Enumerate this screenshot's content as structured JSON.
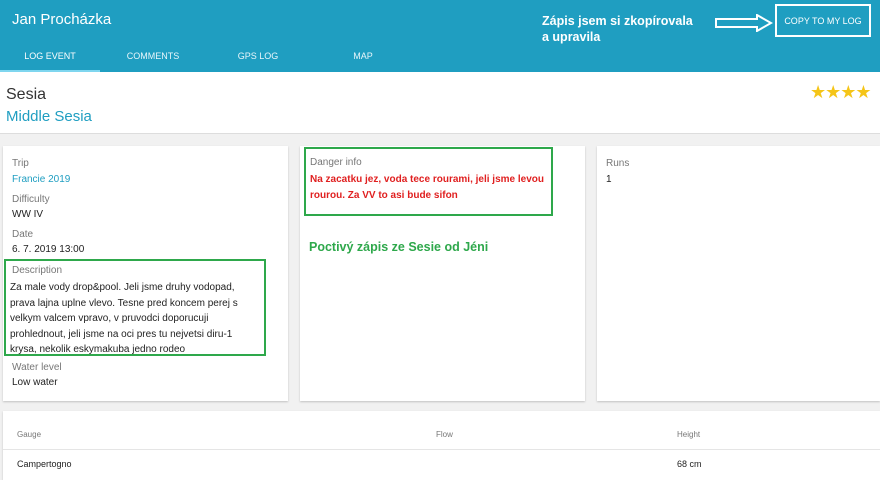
{
  "header": {
    "title": "Jan Procházka",
    "tabs": [
      {
        "label": "LOG EVENT"
      },
      {
        "label": "COMMENTS"
      },
      {
        "label": "GPS LOG"
      },
      {
        "label": "MAP"
      }
    ],
    "annotation_line1": "Zápis jsem si zkopírovala",
    "annotation_line2": "a upravila",
    "copy_button": "COPY TO MY LOG"
  },
  "river": {
    "name": "Sesia",
    "section": "Middle Sesia",
    "rating_stars": 4,
    "stars_text": "★★★★"
  },
  "details": {
    "trip_label": "Trip",
    "trip_value": "Francie 2019",
    "difficulty_label": "Difficulty",
    "difficulty_value": "WW IV",
    "date_label": "Date",
    "date_value": "6. 7. 2019 13:00",
    "description_label": "Description",
    "description_value": "Za male vody drop&pool. Jeli jsme druhy vodopad, prava lajna uplne vlevo. Tesne pred koncem perej s velkym valcem vpravo, v pruvodci doporucuji prohlednout, jeli jsme na oci pres tu nejvetsi diru-1 krysa, nekolik eskymakuba jedno rodeo",
    "water_level_label": "Water level",
    "water_level_value": "Low water"
  },
  "danger": {
    "label": "Danger info",
    "value": "Na zacatku jez, voda tece rourami, jeli jsme levou rourou. Za VV to asi bude sifon",
    "note": "Poctivý zápis ze Sesie od Jéni"
  },
  "runs": {
    "label": "Runs",
    "value": "1"
  },
  "gauge_table": {
    "headers": {
      "gauge": "Gauge",
      "flow": "Flow",
      "height": "Height"
    },
    "rows": [
      {
        "gauge": "Campertogno",
        "flow": "",
        "height": "68 cm"
      }
    ]
  },
  "colors": {
    "header_bg": "#1f9ec1",
    "annotation_green": "#2ea84b",
    "danger_red": "#e02020",
    "star": "#f5c518"
  }
}
